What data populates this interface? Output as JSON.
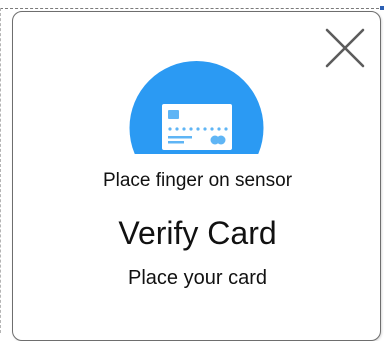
{
  "dialog": {
    "icon": "credit-card-icon",
    "hint": "Place finger on sensor",
    "title": "Verify Card",
    "instruction": "Place your card",
    "close_icon": "close-icon",
    "accent_color": "#2b9af3"
  }
}
